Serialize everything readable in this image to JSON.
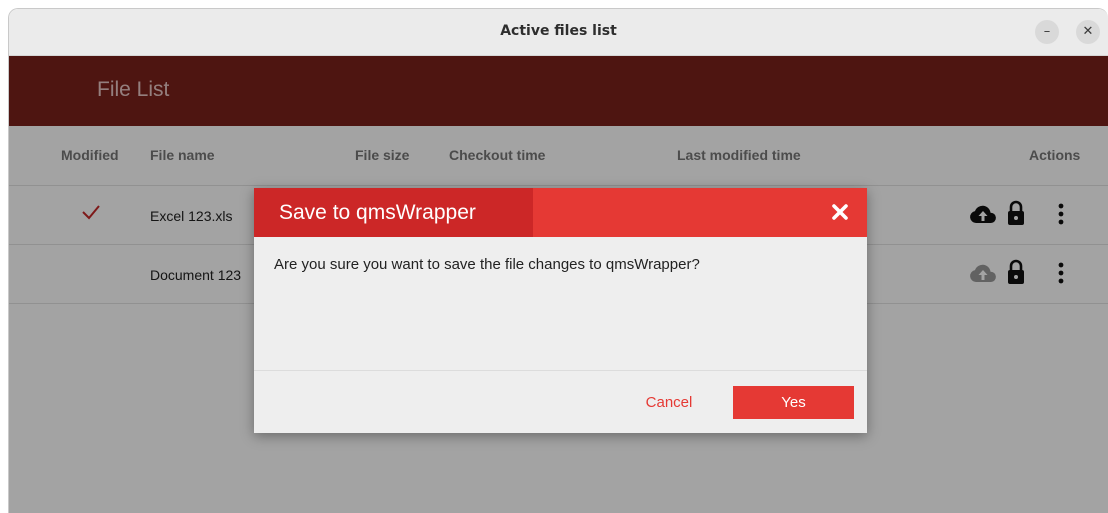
{
  "window": {
    "title": "Active files list",
    "minimize_label": "–",
    "close_label": "✕"
  },
  "app": {
    "title": "File List"
  },
  "table": {
    "columns": {
      "modified": "Modified",
      "file_name": "File name",
      "file_size": "File size",
      "checkout_time": "Checkout time",
      "last_modified_time": "Last modified time",
      "actions": "Actions"
    },
    "rows": [
      {
        "modified": true,
        "file_name": "Excel 123.xls",
        "upload_icon": "cloud-upload-icon",
        "upload_enabled": true
      },
      {
        "modified": false,
        "file_name": "Document 123",
        "upload_icon": "cloud-upload-icon",
        "upload_enabled": false
      }
    ]
  },
  "dialog": {
    "title": "Save to qmsWrapper",
    "message": "Are you sure you want to save the file changes to qmsWrapper?",
    "cancel_label": "Cancel",
    "confirm_label": "Yes"
  },
  "colors": {
    "appbar": "#7b211c",
    "dialog_header": "#e53934",
    "dialog_title_tab": "#cc2727",
    "accent": "#e53934",
    "check": "#c62828"
  }
}
